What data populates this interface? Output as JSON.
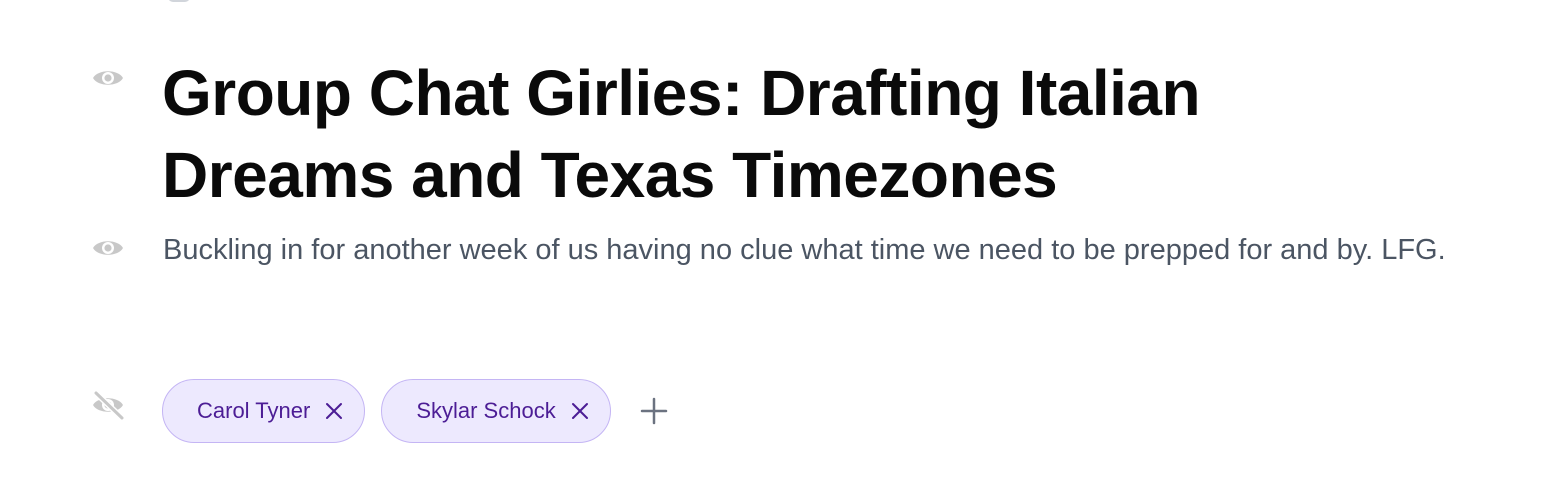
{
  "header": {
    "title": "Group Chat Girlies: Drafting Italian Dreams and Texas Timezones",
    "description": "Buckling in for another week of us having no clue what time we need to be prepped for and by. LFG."
  },
  "visibility": {
    "title_icon": "eye-icon",
    "description_icon": "eye-icon",
    "tags_icon": "eye-off-icon"
  },
  "tags": {
    "items": [
      {
        "label": "Carol Tyner",
        "remove_icon": "close-icon"
      },
      {
        "label": "Skylar Schock",
        "remove_icon": "close-icon"
      }
    ],
    "add_icon": "plus-icon"
  },
  "colors": {
    "tag_background": "#ede9fe",
    "tag_border": "#c4b5f4",
    "tag_text": "#4c1d95",
    "icon_gray": "#c8c8c8",
    "description_text": "#4b5563"
  }
}
